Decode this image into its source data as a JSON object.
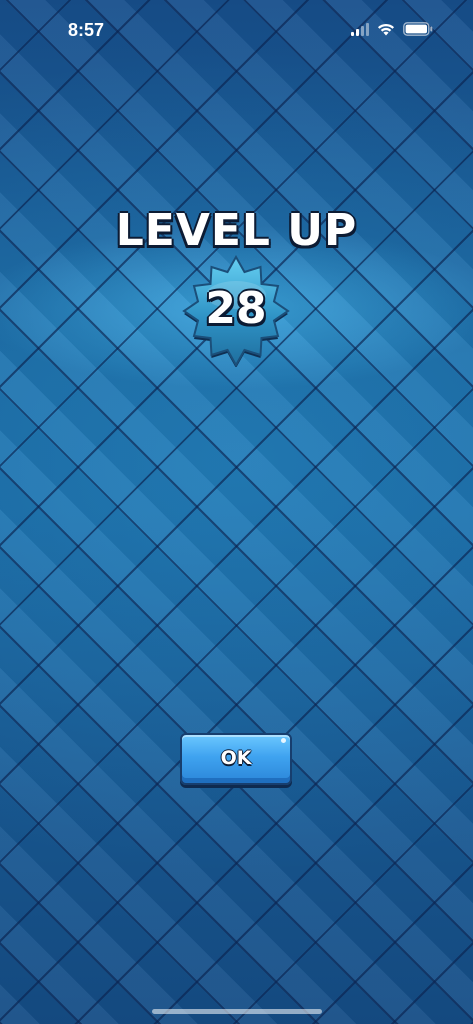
{
  "status_bar": {
    "time": "8:57",
    "signal_icon": "cellular-signal-icon",
    "wifi_icon": "wifi-icon",
    "battery_icon": "battery-icon"
  },
  "level_up": {
    "title": "LEVEL UP",
    "level": "28",
    "badge_icon": "star-badge-icon",
    "badge_color": "#3aa7d6"
  },
  "actions": {
    "ok_label": "OK",
    "ok_color": "#3fa3f0"
  },
  "background": {
    "pattern": "diamond-tiles",
    "base_color": "#1a5c9a"
  }
}
